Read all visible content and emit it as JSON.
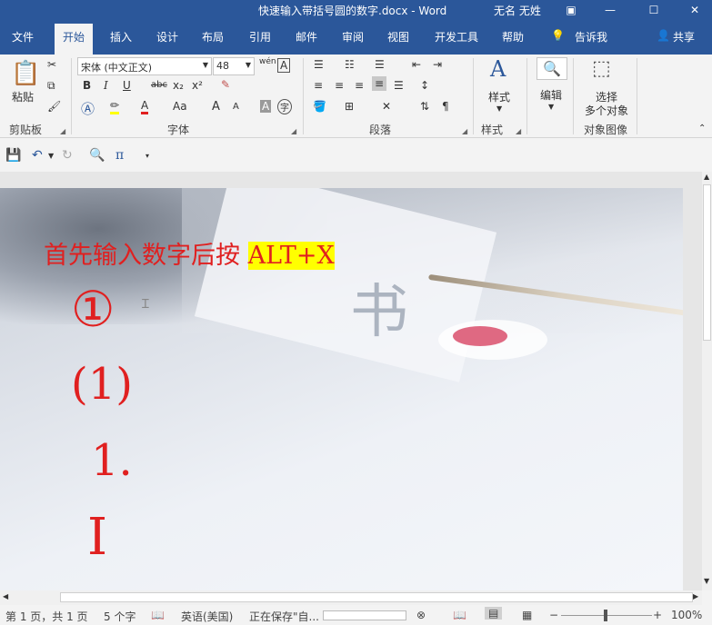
{
  "titlebar": {
    "title": "快速输入带括号圆的数字.docx  -  Word",
    "user": "无名 无姓",
    "ribbon_display_icon": "ribbon-display-icon",
    "minimize": "—",
    "maximize": "☐",
    "close": "✕"
  },
  "tabs": [
    "文件",
    "开始",
    "插入",
    "设计",
    "布局",
    "引用",
    "邮件",
    "审阅",
    "视图",
    "开发工具",
    "帮助"
  ],
  "tell_me": "告诉我",
  "share": "共享",
  "ribbon": {
    "clipboard": {
      "paste": "粘贴",
      "label": "剪贴板"
    },
    "font": {
      "font_name": "宋体 (中文正文)",
      "font_size": "48",
      "phonetic": "wén",
      "label": "字体",
      "bold": "B",
      "italic": "I",
      "underline": "U",
      "strikethrough": "abc",
      "subscript": "x₂",
      "superscript": "x²",
      "change_case": "Aa",
      "grow": "A",
      "shrink": "A",
      "char_shading": "A",
      "enclose": "字",
      "border_char": "A"
    },
    "paragraph": {
      "label": "段落"
    },
    "styles": {
      "button": "样式",
      "label": "样式"
    },
    "editing": {
      "button": "编辑"
    },
    "select_objects": {
      "line1": "选择",
      "line2": "多个对象",
      "label": "对象图像"
    }
  },
  "qat": {
    "pi": "π"
  },
  "document": {
    "line1_text": "首先输入数字后按",
    "line1_highlight": "ALT+X",
    "symbols": [
      "①",
      "(1)",
      "1.",
      "Ⅰ"
    ],
    "calligraphy": "书"
  },
  "status": {
    "page": "第 1 页，共 1 页",
    "words": "5 个字",
    "language": "英语(美国)",
    "saving": "正在保存\"自...",
    "zoom": "100%"
  },
  "colors": {
    "brand": "#2b579a",
    "doc_text": "#e02020",
    "highlight": "#ffff00"
  }
}
